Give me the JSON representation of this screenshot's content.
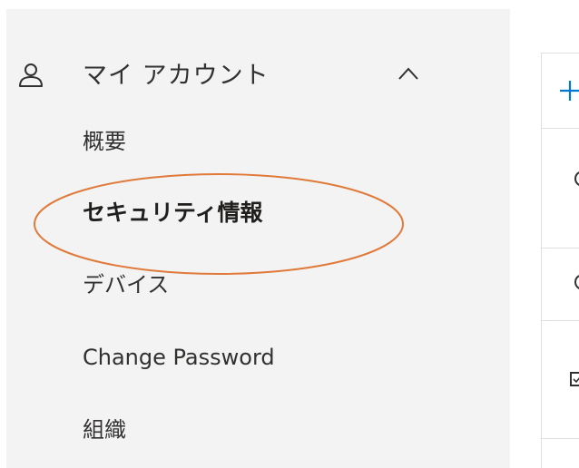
{
  "nav": {
    "header_label": "マイ アカウント",
    "items": [
      {
        "label": "概要"
      },
      {
        "label": "セキュリティ情報"
      },
      {
        "label": "デバイス"
      },
      {
        "label": "Change Password"
      },
      {
        "label": "組織"
      }
    ],
    "active_item": "セキュリティ情報"
  },
  "colors": {
    "sidebar_bg": "#f3f3f3",
    "text": "#323130",
    "accent_blue": "#0078d4",
    "highlight_orange": "#e07a3a"
  },
  "icons": {
    "header": "user-icon",
    "collapse": "chevron-up-icon",
    "add": "plus-icon"
  }
}
